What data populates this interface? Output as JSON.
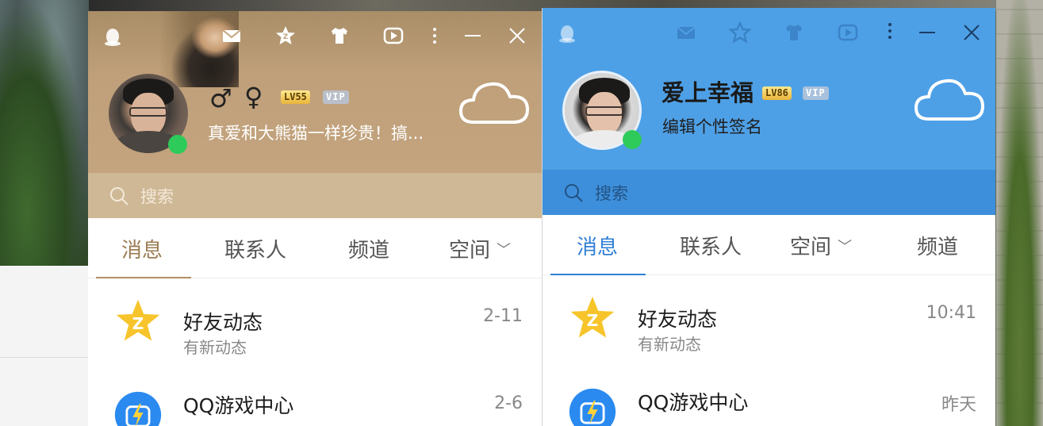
{
  "left_window": {
    "gender_male": "♂",
    "gender_female": "♀",
    "level_badge": "LV55",
    "vip_badge": "VIP",
    "signature": "真爱和大熊猫一样珍贵！搞...",
    "search_placeholder": "搜索",
    "tabs": [
      {
        "label": "消息"
      },
      {
        "label": "联系人"
      },
      {
        "label": "频道"
      },
      {
        "label": "空间"
      }
    ],
    "items": [
      {
        "name": "好友动态",
        "sub": "有新动态",
        "time": "2-11",
        "icon": "qzone-star-icon"
      },
      {
        "name": "QQ游戏中心",
        "sub": "",
        "time": "2-6",
        "icon": "game-center-icon"
      }
    ]
  },
  "right_window": {
    "nickname": "爱上幸福",
    "level_badge": "LV86",
    "vip_badge": "VIP",
    "signature": "编辑个性签名",
    "search_placeholder": "搜索",
    "tabs": [
      {
        "label": "消息"
      },
      {
        "label": "联系人"
      },
      {
        "label": "空间"
      },
      {
        "label": "频道"
      }
    ],
    "items": [
      {
        "name": "好友动态",
        "sub": "有新动态",
        "time": "10:41",
        "icon": "qzone-star-icon"
      },
      {
        "name": "QQ游戏中心",
        "sub": "",
        "time": "昨天",
        "icon": "game-center-icon"
      }
    ]
  },
  "colors": {
    "tan_header": "#c3a47e",
    "blue_header": "#4ea0e6",
    "online": "#2ecb5a",
    "qzone_star": "#f7c52b",
    "game_center": "#2a8af0"
  }
}
